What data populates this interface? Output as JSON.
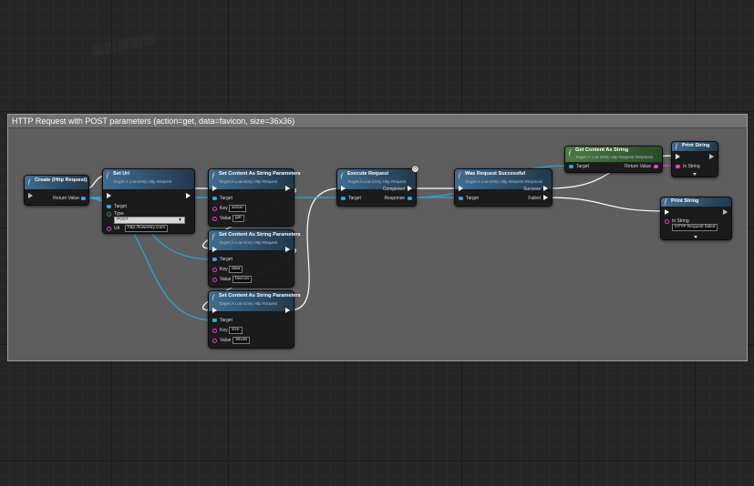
{
  "comment": {
    "title": "HTTP Request with POST parameters (action=get, data=favicon, size=36x36)"
  },
  "nodes": {
    "create_http_request": {
      "title": "Create (Http Request)",
      "return_value": "Return Value"
    },
    "set_url": {
      "title": "Set Url",
      "subtitle": "Target is Low Entry Http Request",
      "target": "Target",
      "type_label": "Type",
      "type_value": "POST",
      "url_label": "Url",
      "url_value": "http://lowentry.com/"
    },
    "set_content_1": {
      "title": "Set Content As String Parameters",
      "subtitle": "Target is Low Entry Http Request",
      "target": "Target",
      "key_label": "Key",
      "key_value": "action",
      "value_label": "Value",
      "value_value": "get"
    },
    "set_content_2": {
      "title": "Set Content As String Parameters",
      "subtitle": "Target is Low Entry Http Request",
      "target": "Target",
      "key_label": "Key",
      "key_value": "data",
      "value_label": "Value",
      "value_value": "favicon"
    },
    "set_content_3": {
      "title": "Set Content As String Parameters",
      "subtitle": "Target is Low Entry Http Request",
      "target": "Target",
      "key_label": "Key",
      "key_value": "size",
      "value_label": "Value",
      "value_value": "36x36"
    },
    "execute_request": {
      "title": "Execute Request",
      "subtitle": "Target is Low Entry Http Request",
      "target": "Target",
      "completed": "Completed",
      "response": "Response"
    },
    "was_request_successful": {
      "title": "Was Request Successful",
      "subtitle": "Target is Low Entry Http Request Response",
      "target": "Target",
      "success": "Success",
      "failed": "Failed"
    },
    "get_content_as_string": {
      "title": "Get Content As String",
      "subtitle": "Target is Low Entry Http Request Response",
      "target": "Target",
      "return_value": "Return Value"
    },
    "print_string_1": {
      "title": "Print String",
      "in_string_label": "In String"
    },
    "print_string_2": {
      "title": "Print String",
      "in_string_label": "In String",
      "in_string_value": "HTTP Request failed"
    }
  },
  "icons": {
    "function": "function-icon",
    "latent": "clock-icon"
  },
  "colors": {
    "exec_wire": "#ffffff",
    "object_wire": "#2ea8d8",
    "string_wire": "#e040c8",
    "function_header": "#3f6d90",
    "pure_header": "#4e8a46",
    "comment_bg": "#5e5e5e"
  }
}
